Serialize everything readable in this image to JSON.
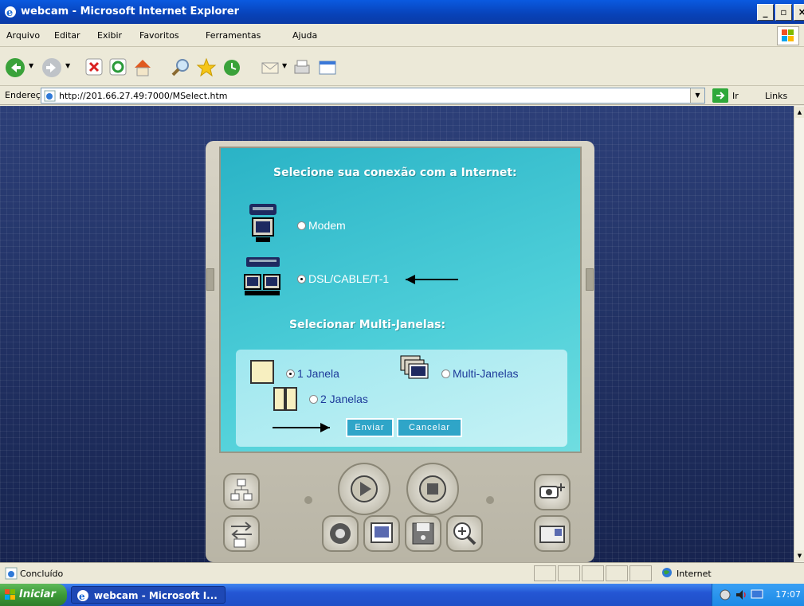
{
  "window": {
    "title": "webcam - Microsoft Internet Explorer",
    "minimize": "_",
    "maximize": "▫",
    "close": "×"
  },
  "menu": [
    "Arquivo",
    "Editar",
    "Exibir",
    "Favoritos",
    "Ferramentas",
    "Ajuda"
  ],
  "toolbar": {
    "icons": [
      "back-icon",
      "forward-icon",
      "stop-icon",
      "refresh-icon",
      "home-icon",
      "search-icon",
      "favorites-icon",
      "history-icon",
      "mail-icon",
      "print-icon",
      "edit-icon"
    ]
  },
  "address": {
    "label": "Endereço",
    "url": "http://201.66.27.49:7000/MSelect.htm",
    "go_label": "Ir",
    "links_label": "Links"
  },
  "page": {
    "connection_heading": "Selecione sua conexão com a Internet:",
    "option_modem": "Modem",
    "option_dsl": "DSL/CABLE/T-1",
    "multi_heading": "Selecionar Multi-Janelas:",
    "option_1_janela": "1 Janela",
    "option_multi": "Multi-Janelas",
    "option_2_janelas": "2 Janelas",
    "submit_label": "Enviar",
    "cancel_label": "Cancelar",
    "selected_connection": "DSL/CABLE/T-1",
    "selected_window": "1 Janela"
  },
  "status": {
    "text": "Concluído",
    "zone": "Internet"
  },
  "taskbar": {
    "start_label": "Iniciar",
    "task_label": "webcam - Microsoft I...",
    "clock": "17:07"
  },
  "colors": {
    "titlebar": "#0842b8",
    "screen": "#4ecfd9",
    "button": "#2fa5c8",
    "taskbar": "#2456d4"
  }
}
